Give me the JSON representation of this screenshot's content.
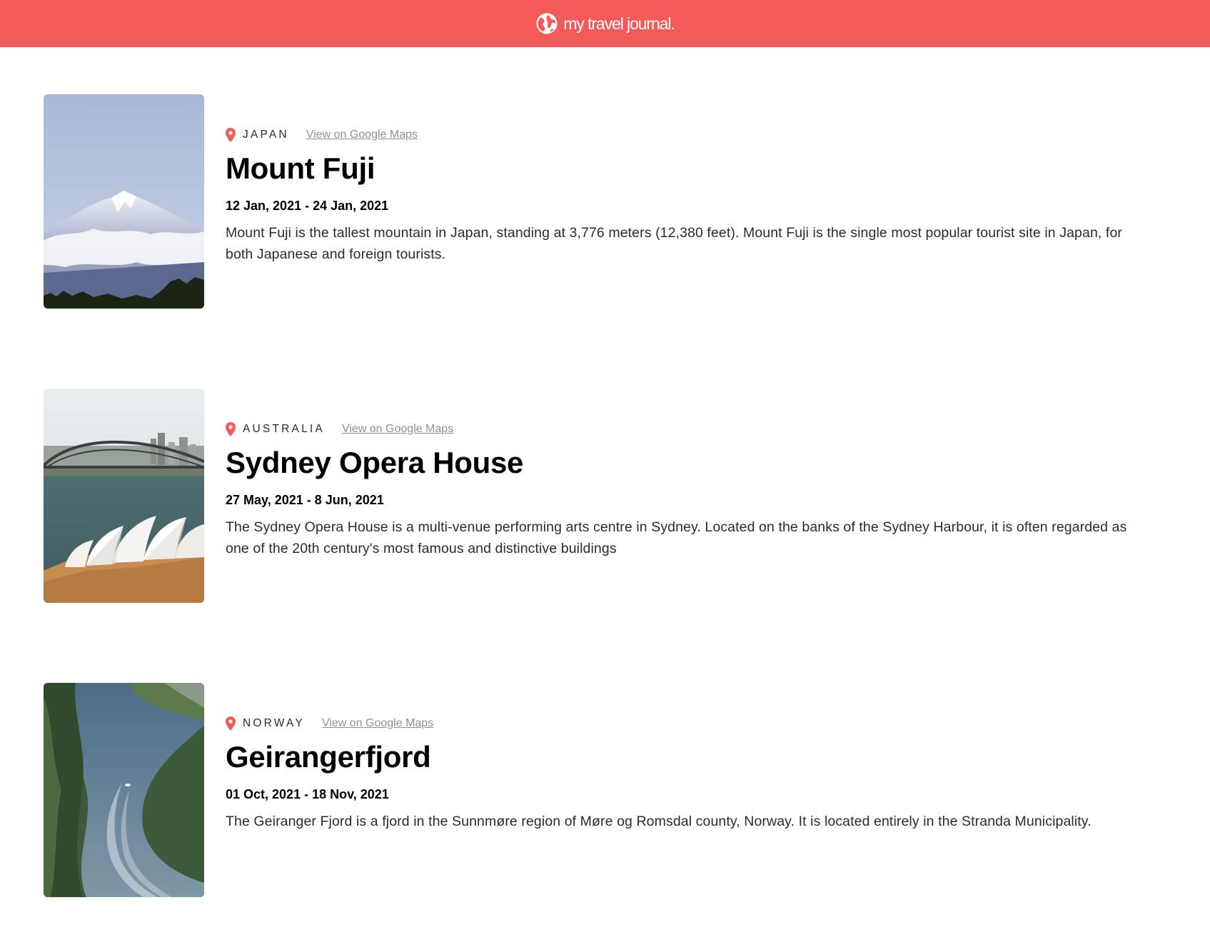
{
  "header": {
    "brand": "my travel journal.",
    "icon": "globe-icon",
    "bg_color": "#F55A5A"
  },
  "entries": [
    {
      "country": "JAPAN",
      "maps_label": "View on Google Maps",
      "title": "Mount Fuji",
      "dates": "12 Jan, 2021 - 24 Jan, 2021",
      "description": "Mount Fuji is the tallest mountain in Japan, standing at 3,776 meters (12,380 feet). Mount Fuji is the single most popular tourist site in Japan, for both Japanese and foreign tourists."
    },
    {
      "country": "AUSTRALIA",
      "maps_label": "View on Google Maps",
      "title": "Sydney Opera House",
      "dates": "27 May, 2021 - 8 Jun, 2021",
      "description": "The Sydney Opera House is a multi-venue performing arts centre in Sydney. Located on the banks of the Sydney Harbour, it is often regarded as one of the 20th century's most famous and distinctive buildings"
    },
    {
      "country": "NORWAY",
      "maps_label": "View on Google Maps",
      "title": "Geirangerfjord",
      "dates": "01 Oct, 2021 - 18 Nov, 2021",
      "description": "The Geiranger Fjord is a fjord in the Sunnmøre region of Møre og Romsdal county, Norway. It is located entirely in the Stranda Municipality."
    }
  ]
}
